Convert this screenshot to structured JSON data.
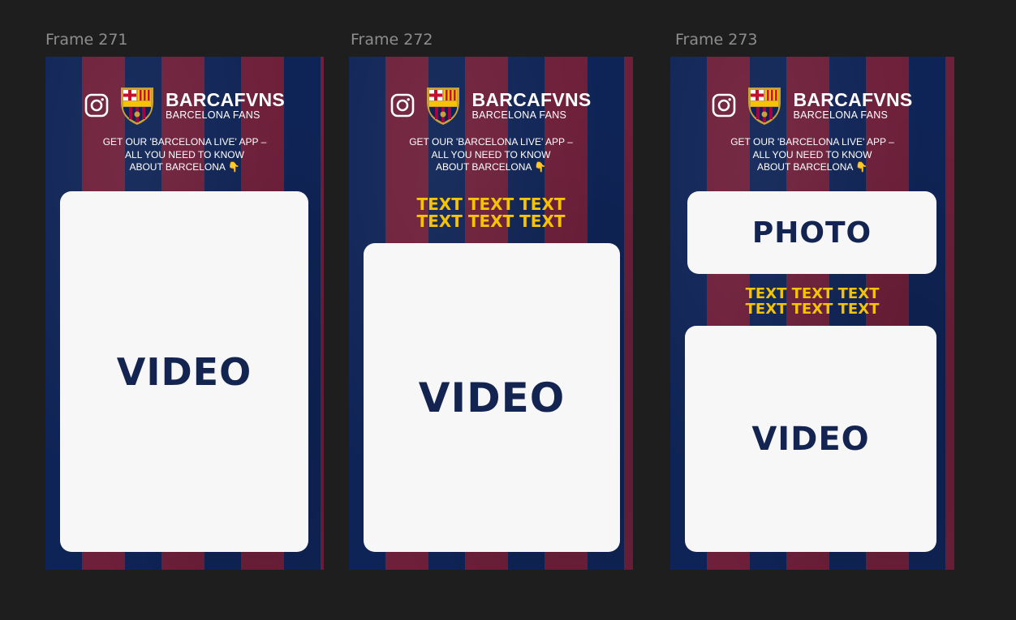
{
  "frames": [
    {
      "label": "Frame 271",
      "brand_name": "BARCAFVNS",
      "brand_sub": "BARCELONA FANS",
      "promo_lines": [
        "GET OUR 'BARCELONA LIVE' APP –",
        "ALL YOU NEED TO KNOW",
        "ABOUT BARCELONA 👇"
      ],
      "video_label": "VIDEO"
    },
    {
      "label": "Frame 272",
      "brand_name": "BARCAFVNS",
      "brand_sub": "BARCELONA FANS",
      "promo_lines": [
        "GET OUR 'BARCELONA LIVE' APP –",
        "ALL YOU NEED TO KNOW",
        "ABOUT BARCELONA 👇"
      ],
      "headline_lines": [
        "TEXT TEXT TEXT",
        "TEXT TEXT TEXT"
      ],
      "video_label": "VIDEO"
    },
    {
      "label": "Frame 273",
      "brand_name": "BARCAFVNS",
      "brand_sub": "BARCELONA FANS",
      "promo_lines": [
        "GET OUR 'BARCELONA LIVE' APP –",
        "ALL YOU NEED TO KNOW",
        "ABOUT BARCELONA 👇"
      ],
      "photo_label": "PHOTO",
      "headline_lines": [
        "TEXT TEXT TEXT",
        "TEXT TEXT TEXT"
      ],
      "video_label": "VIDEO"
    }
  ],
  "icons": {
    "instagram": "instagram-icon",
    "crest": "fcb-crest-icon"
  },
  "colors": {
    "canvas_bg": "#1e1e1e",
    "stripe_blue": "#0f2456",
    "stripe_red": "#6e1f3a",
    "accent_yellow": "#f6c300",
    "card_bg": "#f7f7f8",
    "card_text": "#142451",
    "label_gray": "#8d8d8d"
  }
}
